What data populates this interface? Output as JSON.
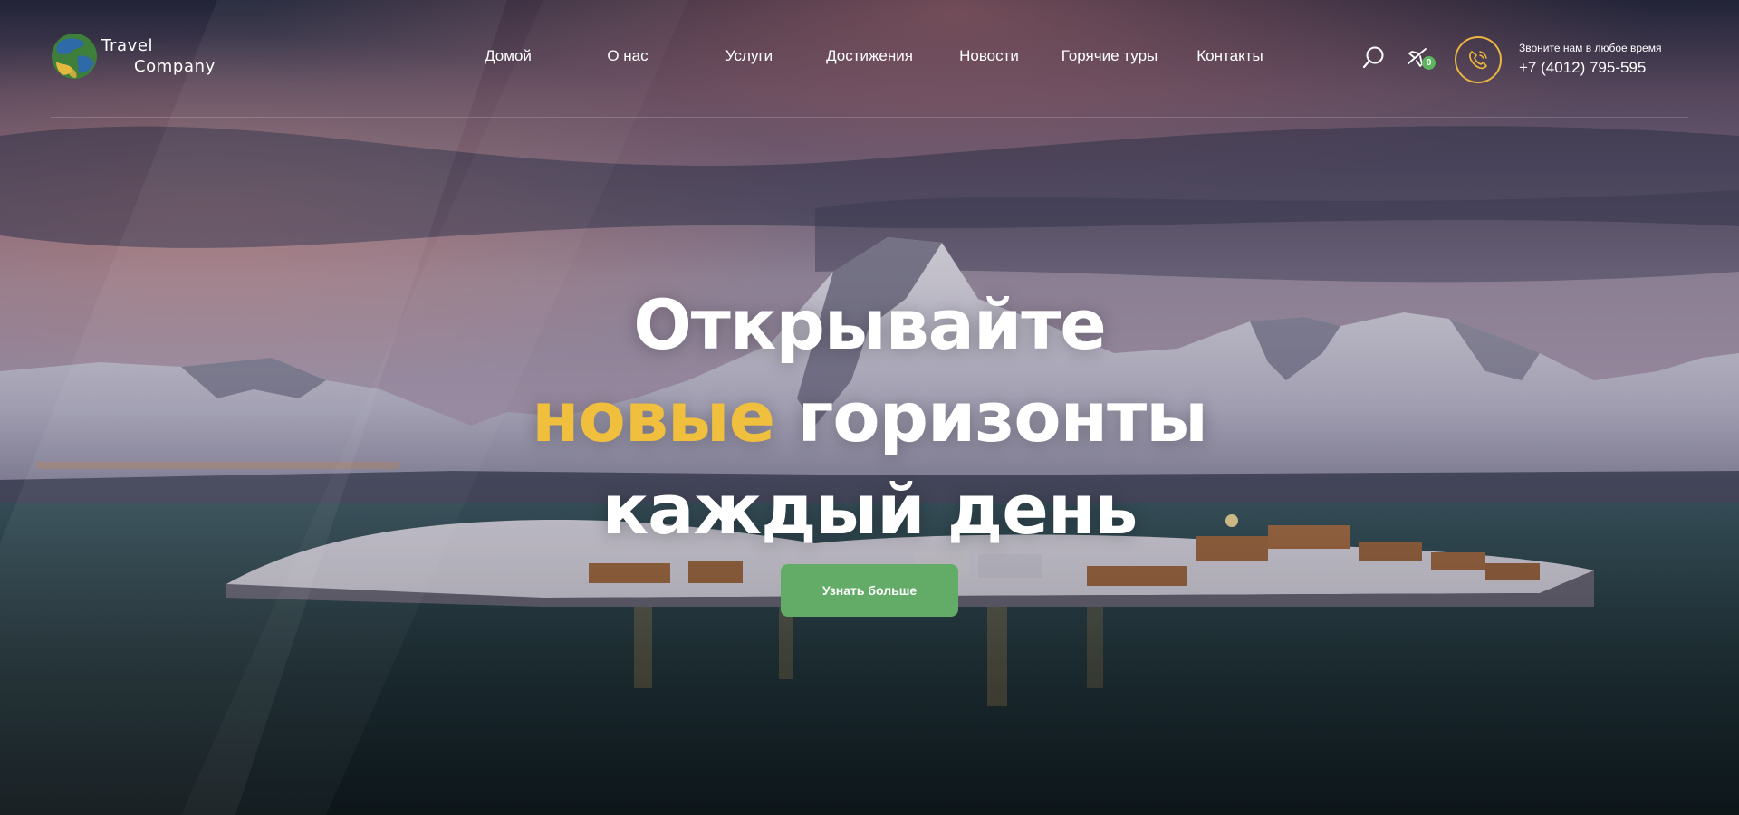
{
  "brand": {
    "line1": "Travel",
    "line2": "Company"
  },
  "nav": {
    "items": [
      {
        "label": "Домой"
      },
      {
        "label": "О нас"
      },
      {
        "label": "Услуги"
      },
      {
        "label": "Достижения"
      },
      {
        "label": "Новости"
      },
      {
        "label": "Горячие туры"
      },
      {
        "label": "Контакты"
      }
    ]
  },
  "header": {
    "search_icon": "search-icon",
    "flights_icon": "airplane-icon",
    "flights_count": "0",
    "phone_icon": "phone-icon",
    "phone_caption": "Звоните нам в любое время",
    "phone_number": "+7 (4012) 795-595"
  },
  "hero": {
    "line1": "Открывайте",
    "line2_accent": "новые",
    "line2_rest": "горизонты",
    "line3": "каждый день",
    "cta_label": "Узнать больше"
  },
  "colors": {
    "accent_yellow": "#f0bf3d",
    "cta_green": "#63ac67",
    "badge_green": "#5db55f"
  }
}
